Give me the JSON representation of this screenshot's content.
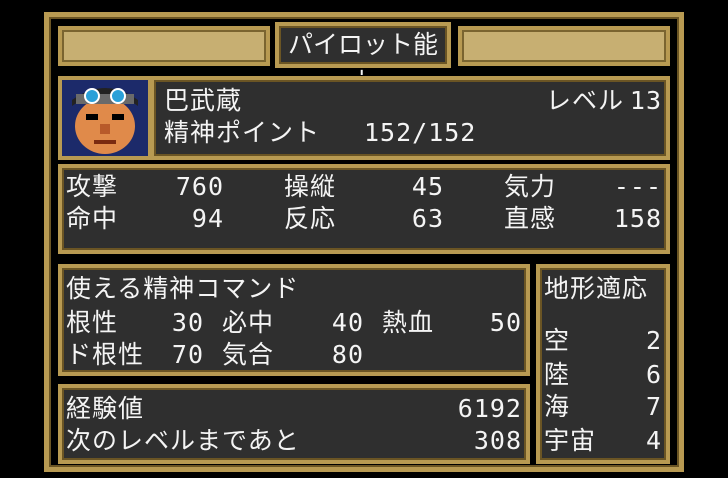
{
  "screen_title": "パイロット能力",
  "pilot": {
    "name": "巴武蔵",
    "level_label": "レベル",
    "level": "13",
    "sp_label": "精神ポイント",
    "sp_value": "152/152"
  },
  "stats": {
    "attack_label": "攻撃",
    "attack": "760",
    "hit_label": "命中",
    "hit": "94",
    "skill_label": "操縦",
    "skill": "45",
    "reaction_label": "反応",
    "reaction": "63",
    "will_label": "気力",
    "will": "---",
    "intuition_label": "直感",
    "intuition": "158"
  },
  "spirit": {
    "heading": "使える精神コマンド",
    "c1_name": "根性",
    "c1_cost": "30",
    "c2_name": "必中",
    "c2_cost": "40",
    "c3_name": "熱血",
    "c3_cost": "50",
    "c4_name": "ド根性",
    "c4_cost": "70",
    "c5_name": "気合",
    "c5_cost": "80"
  },
  "terrain": {
    "heading": "地形適応",
    "air_label": "空",
    "air": "2",
    "land_label": "陸",
    "land": "6",
    "sea_label": "海",
    "sea": "7",
    "space_label": "宇宙",
    "space": "4"
  },
  "exp": {
    "exp_label": "経験値",
    "exp": "6192",
    "next_label": "次のレベルまであと",
    "next": "308"
  },
  "colors": {
    "panel": "#2f2f2f",
    "border": "#b89a52",
    "gold_bar": "#c7af72",
    "text": "#f4f4f4"
  }
}
